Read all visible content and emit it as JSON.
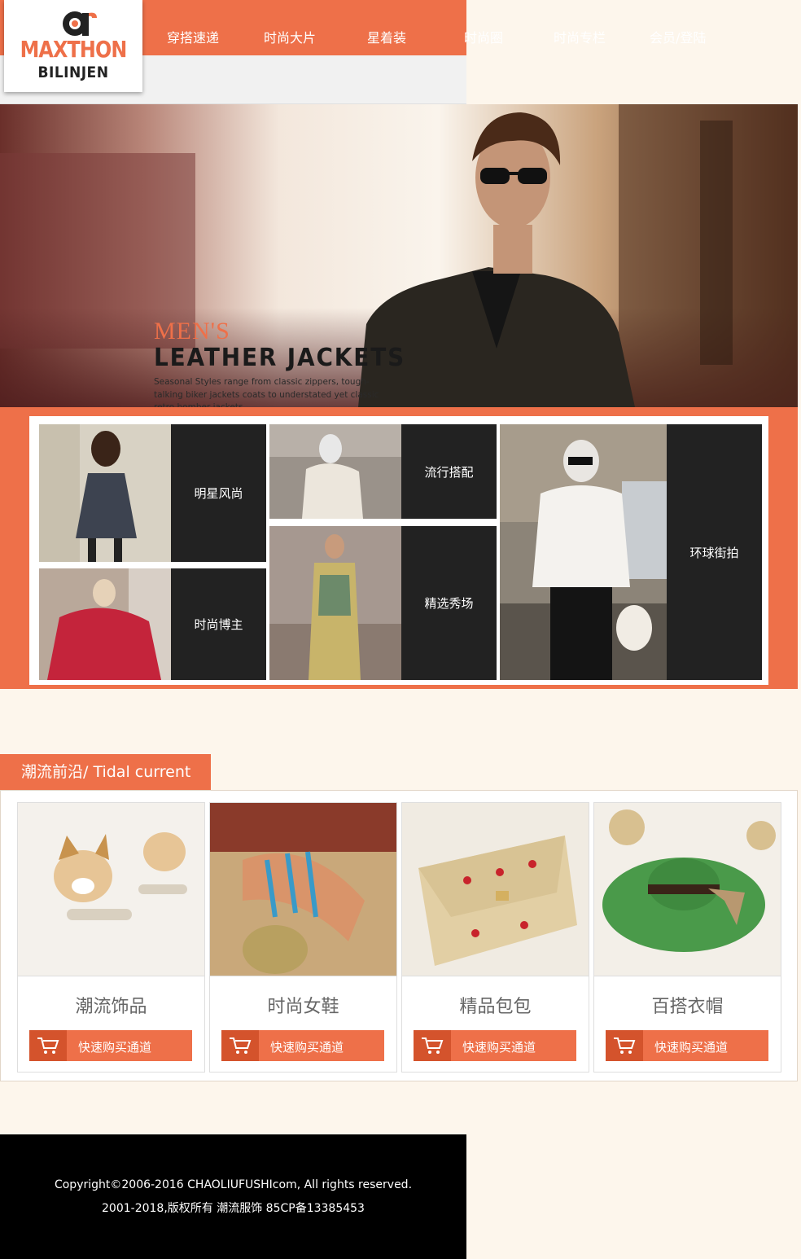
{
  "logo": {
    "line1": "MAXTHON",
    "line2": "BILINJEN"
  },
  "nav": [
    "穿搭速递",
    "时尚大片",
    "星着装",
    "时尚圈",
    "时尚专栏",
    "会员/登陆"
  ],
  "banner": {
    "title1": "MEN'S",
    "title2": "LEATHER JACKETS",
    "desc": "Seasonal Styles range from classic zippers, tough-talking biker jackets coats to understated yet classic retro bomber jackets."
  },
  "categories": [
    "明星风尚",
    "流行搭配",
    "环球街拍",
    "时尚博主",
    "精选秀场"
  ],
  "section": {
    "title": "潮流前沿/ Tidal current"
  },
  "products": [
    {
      "name": "潮流饰品",
      "button": "快速购买通道"
    },
    {
      "name": "时尚女鞋",
      "button": "快速购买通道"
    },
    {
      "name": "精品包包",
      "button": "快速购买通道"
    },
    {
      "name": "百搭衣帽",
      "button": "快速购买通道"
    }
  ],
  "footer": {
    "line1": "Copyright©2006-2016 CHAOLIUFUSHIcom, All rights reserved.",
    "line2": "2001-2018,版权所有 潮流服饰 85CP备13385453"
  },
  "colors": {
    "accent": "#ee7049",
    "dark_tile": "#222222",
    "page_bg": "#fdf6ec",
    "footer_bg": "#000000"
  }
}
